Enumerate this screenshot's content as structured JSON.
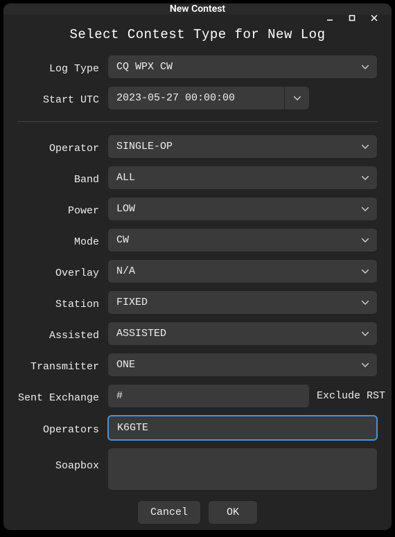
{
  "window": {
    "title": "New Contest"
  },
  "heading": "Select Contest Type for New Log",
  "labels": {
    "logType": "Log Type",
    "startUtc": "Start UTC",
    "operator": "Operator",
    "band": "Band",
    "power": "Power",
    "mode": "Mode",
    "overlay": "Overlay",
    "station": "Station",
    "assisted": "Assisted",
    "transmitter": "Transmitter",
    "sentExchange": "Sent Exchange",
    "excludeRst": "Exclude RST",
    "operators": "Operators",
    "soapbox": "Soapbox"
  },
  "values": {
    "logType": "CQ WPX CW",
    "startUtc": "2023-05-27 00:00:00",
    "operator": "SINGLE-OP",
    "band": "ALL",
    "power": "LOW",
    "mode": "CW",
    "overlay": "N/A",
    "station": "FIXED",
    "assisted": "ASSISTED",
    "transmitter": "ONE",
    "sentExchange": "#",
    "operators": "K6GTE",
    "soapbox": ""
  },
  "buttons": {
    "cancel": "Cancel",
    "ok": "OK"
  }
}
